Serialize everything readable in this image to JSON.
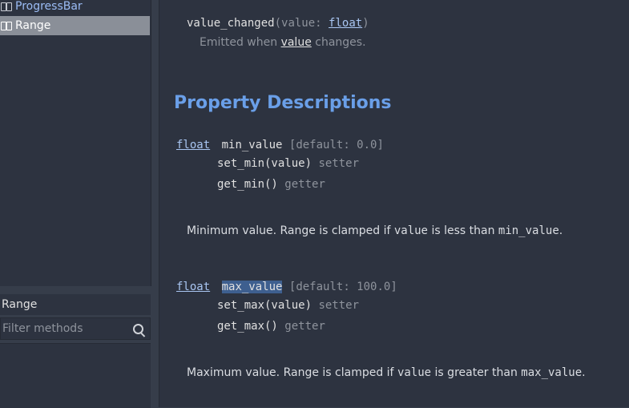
{
  "tree": {
    "items": [
      {
        "label": "ProgressBar",
        "icon": "node-icon",
        "selected": false
      },
      {
        "label": "Range",
        "icon": "node-icon",
        "selected": true
      }
    ]
  },
  "panel": {
    "class_label": "Range",
    "filter_placeholder": "Filter methods"
  },
  "signal": {
    "name": "value_changed",
    "open": "(",
    "param": "value: ",
    "param_type": "float",
    "close": ")",
    "desc_pre": "Emitted when ",
    "desc_link": "value",
    "desc_post": " changes."
  },
  "section_title": "Property Descriptions",
  "properties": [
    {
      "type": "float",
      "name": "min_value",
      "default": "[default: 0.0]",
      "setter": "set_min(value)",
      "setter_label": "setter",
      "getter": "get_min()",
      "getter_label": "getter",
      "desc_pre": "Minimum value. Range is clamped if ",
      "desc_code1": "value",
      "desc_mid": " is less than ",
      "desc_code2": "min_value",
      "desc_post": "."
    },
    {
      "type": "float",
      "name": "max_value",
      "default": "[default: 100.0]",
      "setter": "set_max(value)",
      "setter_label": "setter",
      "getter": "get_max()",
      "getter_label": "getter",
      "desc_pre": "Maximum value. Range is clamped if ",
      "desc_code1": "value",
      "desc_mid": " is greater than ",
      "desc_code2": "max_value",
      "desc_post": "."
    }
  ],
  "colors": {
    "accent": "#6a9fe8",
    "selection": "#8a8f98",
    "highlight": "#3e5f8f"
  }
}
